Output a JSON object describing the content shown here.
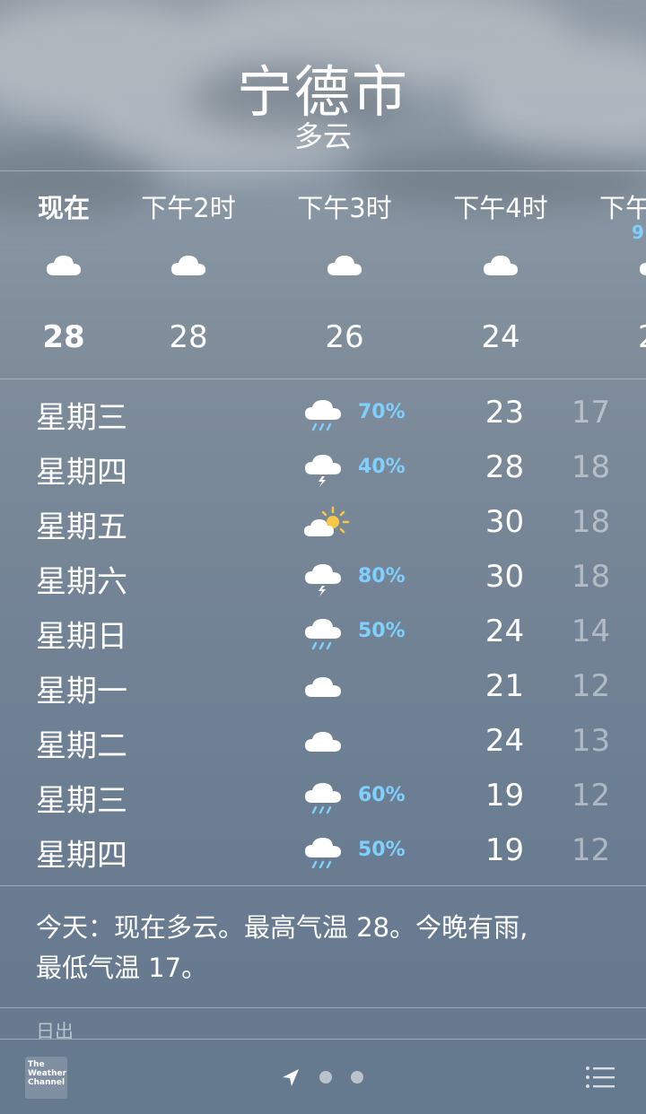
{
  "header": {
    "city": "宁德市",
    "condition": "多云"
  },
  "hourly": [
    {
      "time": "现在",
      "icon": "cloud-icon",
      "temp": "28"
    },
    {
      "time": "下午2时",
      "icon": "cloud-icon",
      "temp": "28"
    },
    {
      "time": "下午3时",
      "icon": "cloud-icon",
      "temp": "26"
    },
    {
      "time": "下午4时",
      "icon": "cloud-icon",
      "temp": "24"
    },
    {
      "time": "下午",
      "icon": "cloud-icon",
      "temp": "2",
      "precip": "9"
    }
  ],
  "daily": [
    {
      "day": "星期三",
      "icon": "rain-icon",
      "precip": "70%",
      "high": "23",
      "low": "17"
    },
    {
      "day": "星期四",
      "icon": "thunderstorm-icon",
      "precip": "40%",
      "high": "28",
      "low": "18"
    },
    {
      "day": "星期五",
      "icon": "partly-sunny-icon",
      "precip": "",
      "high": "30",
      "low": "18"
    },
    {
      "day": "星期六",
      "icon": "thunderstorm-icon",
      "precip": "80%",
      "high": "30",
      "low": "18"
    },
    {
      "day": "星期日",
      "icon": "rain-icon",
      "precip": "50%",
      "high": "24",
      "low": "14"
    },
    {
      "day": "星期一",
      "icon": "cloud-icon",
      "precip": "",
      "high": "21",
      "low": "12"
    },
    {
      "day": "星期二",
      "icon": "cloud-icon",
      "precip": "",
      "high": "24",
      "low": "13"
    },
    {
      "day": "星期三",
      "icon": "rain-icon",
      "precip": "60%",
      "high": "19",
      "low": "12"
    },
    {
      "day": "星期四",
      "icon": "rain-icon",
      "precip": "50%",
      "high": "19",
      "low": "12"
    }
  ],
  "summary": {
    "line1": "今天：现在多云。最高气温 28。今晚有雨,",
    "line2": "最低气温 17。"
  },
  "details": {
    "sunrise_label": "日出"
  },
  "footer": {
    "logo_text": "The Weather Channel",
    "logo_line1": "The",
    "logo_line2": "Weather",
    "logo_line3": "Channel",
    "page_count": 3,
    "current_page": 0,
    "location_icon": "location-arrow-icon",
    "list_icon": "list-icon"
  },
  "colors": {
    "precip": "#7fd0ff",
    "sun": "#f7c843",
    "background_top": "#8f99a3",
    "background_bottom": "#667a8f"
  }
}
